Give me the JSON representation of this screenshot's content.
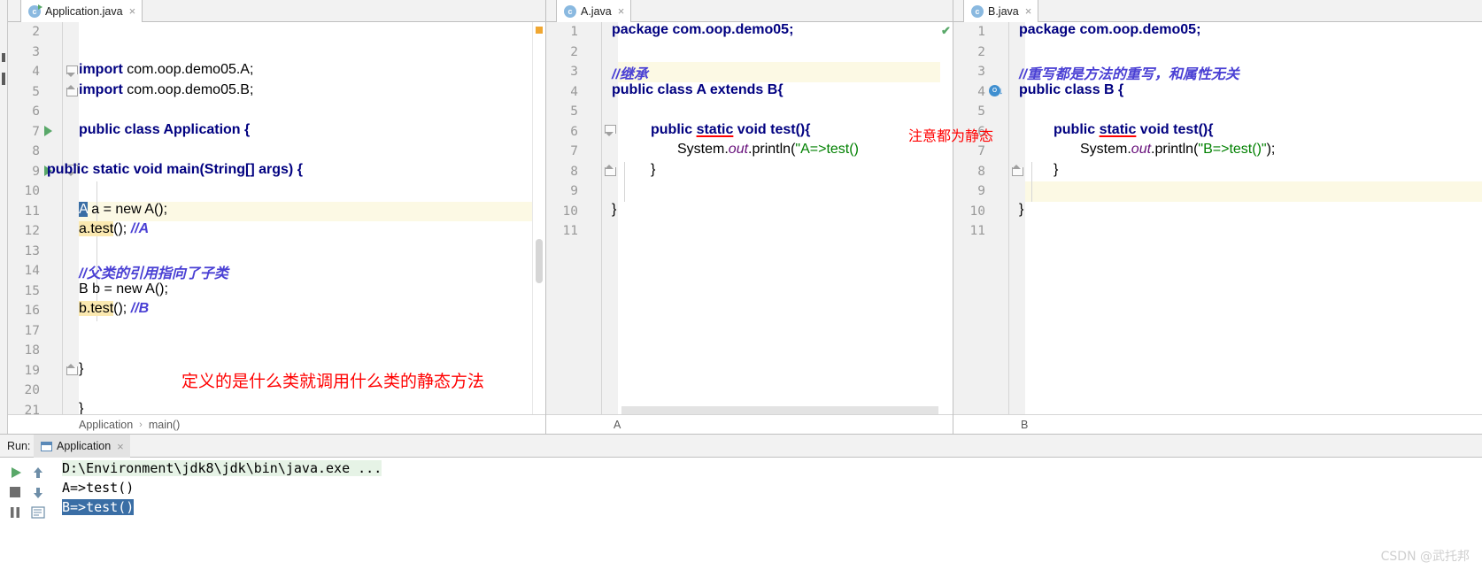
{
  "window": {
    "watermark": "CSDN @武托邦"
  },
  "tabs": [
    {
      "label": "Application.java",
      "icon": "java-class-icon",
      "close": "×"
    },
    {
      "label": "A.java",
      "icon": "java-class-icon",
      "close": "×"
    },
    {
      "label": "B.java",
      "icon": "java-class-icon",
      "close": "×"
    }
  ],
  "editors": {
    "application": {
      "breadcrumb": [
        "Application",
        "main()"
      ],
      "first_line_number": 2,
      "current_line": 11,
      "lines": [
        {
          "n": 2,
          "text": ""
        },
        {
          "n": 3,
          "text": ""
        },
        {
          "n": 4,
          "text": "import com.oop.demo05.A;"
        },
        {
          "n": 5,
          "text": "import com.oop.demo05.B;"
        },
        {
          "n": 6,
          "text": ""
        },
        {
          "n": 7,
          "text": "public class Application {"
        },
        {
          "n": 8,
          "text": ""
        },
        {
          "n": 9,
          "text": "    public static void main(String[] args) {"
        },
        {
          "n": 10,
          "text": ""
        },
        {
          "n": 11,
          "text": "        A a = new A();"
        },
        {
          "n": 12,
          "text": "        a.test(); //A"
        },
        {
          "n": 13,
          "text": ""
        },
        {
          "n": 14,
          "text": "        //父类的引用指向了子类"
        },
        {
          "n": 15,
          "text": "        B b = new A();"
        },
        {
          "n": 16,
          "text": "        b.test(); //B"
        },
        {
          "n": 17,
          "text": ""
        },
        {
          "n": 18,
          "text": "    }"
        },
        {
          "n": 19,
          "text": ""
        },
        {
          "n": 20,
          "text": "}"
        },
        {
          "n": 21,
          "text": ""
        }
      ]
    },
    "a_java": {
      "breadcrumb": [
        "A"
      ],
      "first_line_number": 1,
      "current_line": 3,
      "lines": [
        {
          "n": 1,
          "text": "package com.oop.demo05;"
        },
        {
          "n": 2,
          "text": ""
        },
        {
          "n": 3,
          "text": "//继承"
        },
        {
          "n": 4,
          "text": "public class A extends B{"
        },
        {
          "n": 5,
          "text": ""
        },
        {
          "n": 6,
          "text": "    public static void test(){"
        },
        {
          "n": 7,
          "text": "        System.out.println(\"A=>test()\");"
        },
        {
          "n": 8,
          "text": "    }"
        },
        {
          "n": 9,
          "text": ""
        },
        {
          "n": 10,
          "text": "}"
        },
        {
          "n": 11,
          "text": ""
        }
      ]
    },
    "b_java": {
      "breadcrumb": [
        "B"
      ],
      "first_line_number": 1,
      "current_line": 9,
      "lines": [
        {
          "n": 1,
          "text": "package com.oop.demo05;"
        },
        {
          "n": 2,
          "text": ""
        },
        {
          "n": 3,
          "text": "//重写都是方法的重写，和属性无关"
        },
        {
          "n": 4,
          "text": "public class B {"
        },
        {
          "n": 5,
          "text": ""
        },
        {
          "n": 6,
          "text": "    public static void test(){"
        },
        {
          "n": 7,
          "text": "        System.out.println(\"B=>test()\");"
        },
        {
          "n": 8,
          "text": "    }"
        },
        {
          "n": 9,
          "text": ""
        },
        {
          "n": 10,
          "text": "}"
        },
        {
          "n": 11,
          "text": ""
        }
      ]
    }
  },
  "code_fragments": {
    "kw_import": "import",
    "import_a": " com.oop.demo05.A;",
    "import_b": " com.oop.demo05.B;",
    "kw_public": "public",
    "kw_class": "class",
    "kw_static": "static",
    "kw_void": "void",
    "kw_new": "new",
    "kw_extends": "extends",
    "app_class_line": "public class Application {",
    "main_sig": "    public static void main(String[] args) {",
    "a_decl_sel": "A",
    "a_decl_rest": " a = new A();",
    "a_test_call": "a.test",
    "a_test_tail": "(); ",
    "a_test_cmt": "//A",
    "cn_cmt_parent": "//父类的引用指向了子类",
    "b_decl": "B b = new A();",
    "b_test_call": "b.test",
    "b_test_tail": "(); ",
    "b_test_cmt": "//B",
    "brace_close": "}",
    "pkg_decl": "package com.oop.demo05;",
    "cn_cmt_inherit": "//继承",
    "cn_cmt_override": "//重写都是方法的重写，和属性无关",
    "class_a_sig": "public class A extends B{",
    "class_b_sig": "public class B {",
    "method_test_sig_pre": "public ",
    "method_test_static": "static",
    "method_test_sig_post": " void test(){",
    "sysout_pre": "System.",
    "sysout_out": "out",
    "sysout_mid": ".println(",
    "sysout_a_str": "\"A=>test()\"",
    "sysout_b_str": "\"B=>test()\"",
    "sysout_post": ");",
    "sysout_a_clip": "\"A=>test()"
  },
  "annotations": [
    {
      "id": "annot-static-note",
      "text": "注意都为静态"
    },
    {
      "id": "annot-define-note",
      "text": "定义的是什么类就调用什么类的静态方法"
    }
  ],
  "run_panel": {
    "run_label": "Run:",
    "tab_label": "Application",
    "tab_close": "×",
    "toolbar": {
      "run": "run-icon",
      "stop": "stop-icon",
      "pause": "pause-icon",
      "up": "↑",
      "down": "↓",
      "wrap": "soft-wrap-icon"
    },
    "output": [
      {
        "text": "D:\\Environment\\jdk8\\jdk\\bin\\java.exe ...",
        "style": "command"
      },
      {
        "text": "A=>test()",
        "style": "plain"
      },
      {
        "text": "B=>test()",
        "style": "selected"
      }
    ]
  },
  "colors": {
    "keyword": "#000080",
    "string": "#008000",
    "comment": "#808080",
    "comment_cn": "#4a40d4",
    "annotation_red": "#ff0000",
    "selection_blue": "#3a6ea5",
    "current_line": "#fcf9e4",
    "identifier_highlight": "#fbe9b1",
    "run_green": "#59a869",
    "gutter_bg": "#f1f1f1"
  }
}
